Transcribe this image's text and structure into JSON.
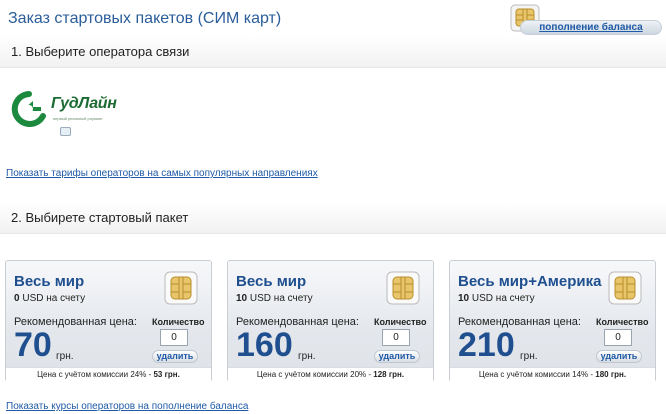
{
  "page": {
    "title": "Заказ стартовых пакетов (СИМ карт)",
    "topup_button": "пополнение баланса"
  },
  "section1": {
    "heading": "1. Выберите оператора связи"
  },
  "operator": {
    "name": "ГудЛайн",
    "slogan": "первый реальный роуминг",
    "icon": "goodline-logo-icon",
    "brand_color": "#1c6b33"
  },
  "links": {
    "tariffs": "Показать тарифы операторов на самых популярных направлениях",
    "rates": "Показать курсы операторов на пополнение баланса"
  },
  "section2": {
    "heading": "2. Выбирете стартовый пакет"
  },
  "packages": [
    {
      "title": "Весь мир",
      "balance_amount": "0",
      "balance_suffix": "USD на счету",
      "rec_label": "Рекомендованная цена:",
      "price": "70",
      "currency": "грн.",
      "qty_label": "Количество",
      "qty_value": "0",
      "delete_label": "удалить",
      "footer_text": "Цена с учётом комиссии 24% - ",
      "footer_price": "53 грн."
    },
    {
      "title": "Весь мир",
      "balance_amount": "10",
      "balance_suffix": "USD на счету",
      "rec_label": "Рекомендованная цена:",
      "price": "160",
      "currency": "грн.",
      "qty_label": "Количество",
      "qty_value": "0",
      "delete_label": "удалить",
      "footer_text": "Цена с учётом комиссии 20% - ",
      "footer_price": "128 грн."
    },
    {
      "title": "Весь мир+Америка",
      "balance_amount": "10",
      "balance_suffix": "USD на счету",
      "rec_label": "Рекомендованная цена:",
      "price": "210",
      "currency": "грн.",
      "qty_label": "Количество",
      "qty_value": "0",
      "delete_label": "удалить",
      "footer_text": "Цена с учётом комиссии 14% - ",
      "footer_price": "180 грн."
    }
  ],
  "colors": {
    "title_blue": "#2a5d9a",
    "price_blue": "#1f4f8f",
    "link_blue": "#1f5aa6",
    "sim_gold": "#e8c56a"
  }
}
